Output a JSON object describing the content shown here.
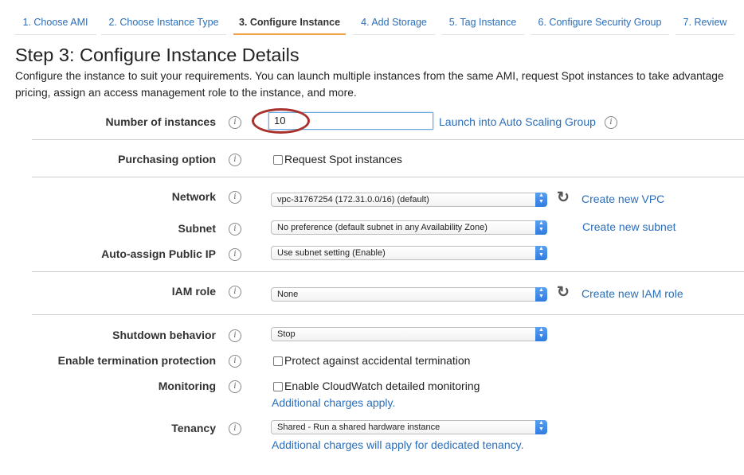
{
  "tabs": [
    {
      "label": "1. Choose AMI"
    },
    {
      "label": "2. Choose Instance Type"
    },
    {
      "label": "3. Configure Instance"
    },
    {
      "label": "4. Add Storage"
    },
    {
      "label": "5. Tag Instance"
    },
    {
      "label": "6. Configure Security Group"
    },
    {
      "label": "7. Review"
    }
  ],
  "page": {
    "title": "Step 3: Configure Instance Details",
    "description_line1": "Configure the instance to suit your requirements. You can launch multiple instances from the same AMI, request Spot instances to take advantage",
    "description_line2": "pricing, assign an access management role to the instance, and more."
  },
  "fields": {
    "number_of_instances": {
      "label": "Number of instances",
      "value": "10",
      "link": "Launch into Auto Scaling Group"
    },
    "purchasing_option": {
      "label": "Purchasing option",
      "checkbox_label": "Request Spot instances",
      "checked": false
    },
    "network": {
      "label": "Network",
      "value": "vpc-31767254 (172.31.0.0/16) (default)",
      "link": "Create new VPC"
    },
    "subnet": {
      "label": "Subnet",
      "value": "No preference (default subnet in any Availability Zone)",
      "link": "Create new subnet"
    },
    "auto_assign_ip": {
      "label": "Auto-assign Public IP",
      "value": "Use subnet setting (Enable)"
    },
    "iam_role": {
      "label": "IAM role",
      "value": "None",
      "link": "Create new IAM role"
    },
    "shutdown_behavior": {
      "label": "Shutdown behavior",
      "value": "Stop"
    },
    "termination_protection": {
      "label": "Enable termination protection",
      "checkbox_label": "Protect against accidental termination",
      "checked": false
    },
    "monitoring": {
      "label": "Monitoring",
      "checkbox_label": "Enable CloudWatch detailed monitoring",
      "checked": false,
      "note": "Additional charges apply."
    },
    "tenancy": {
      "label": "Tenancy",
      "value": "Shared - Run a shared hardware instance",
      "note": "Additional charges will apply for dedicated tenancy."
    }
  },
  "icons": {
    "info": "i",
    "refresh": "↻",
    "select_arrow": "▲▼"
  },
  "colors": {
    "link": "#2a6ebb",
    "active_tab_underline": "#f0a040",
    "highlight_ellipse": "#a8322e"
  }
}
